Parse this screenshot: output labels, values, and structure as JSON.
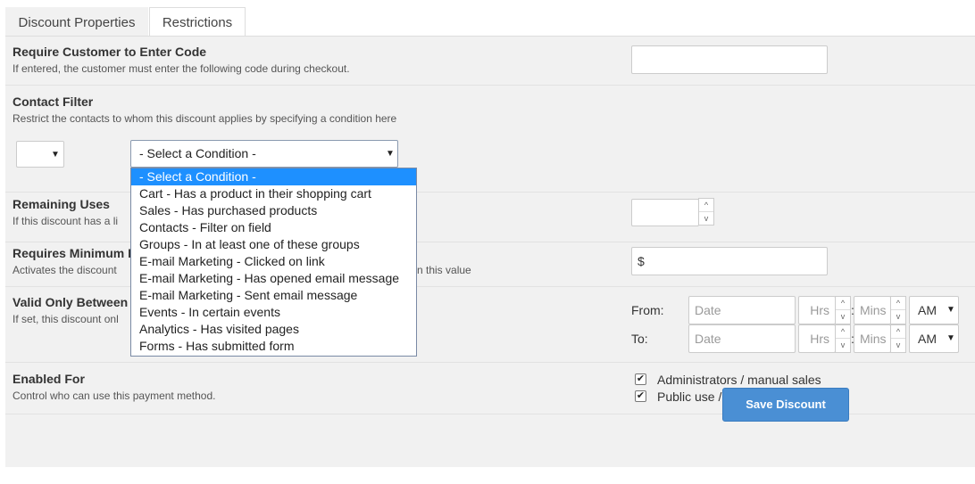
{
  "tabs": {
    "discount_properties": "Discount Properties",
    "restrictions": "Restrictions"
  },
  "require_code": {
    "title": "Require Customer to Enter Code",
    "description": "If entered, the customer must enter the following code during checkout.",
    "value": ""
  },
  "contact_filter": {
    "title": "Contact Filter",
    "description": "Restrict the contacts to whom this discount applies by specifying a condition here",
    "small_select_value": "",
    "condition_select_value": "- Select a Condition -",
    "options": [
      "- Select a Condition -",
      "Cart - Has a product in their shopping cart",
      "Sales - Has purchased products",
      "Contacts - Filter on field",
      "Groups - In at least one of these groups",
      "E-mail Marketing - Clicked on link",
      "E-mail Marketing - Has opened email message",
      "E-mail Marketing - Sent email message",
      "Events - In certain events",
      "Analytics - Has visited pages",
      "Forms - Has submitted form"
    ]
  },
  "remaining_uses": {
    "title": "Remaining Uses",
    "description_visible": "If this discount has a li",
    "value": ""
  },
  "min_purchase": {
    "title_visible": "Requires Minimum I",
    "description_left": "Activates the discount",
    "description_right": "n this value",
    "currency": "$"
  },
  "valid_between": {
    "title": "Valid Only Between",
    "description_visible": "If set, this discount onl",
    "from_label": "From:",
    "to_label": "To:",
    "date_placeholder": "Date",
    "hrs_placeholder": "Hrs",
    "mins_placeholder": "Mins",
    "colon": ":",
    "from_ampm": "AM",
    "to_ampm": "AM"
  },
  "enabled_for": {
    "title": "Enabled For",
    "description": "Control who can use this payment method.",
    "options": [
      {
        "label": "Administrators / manual sales",
        "checked": true
      },
      {
        "label": "Public use / shopping cart",
        "checked": true
      }
    ]
  },
  "save_button": "Save Discount",
  "icons": {
    "arrow": "▼",
    "spin_up": "^",
    "spin_down": "v",
    "check": "✔"
  }
}
